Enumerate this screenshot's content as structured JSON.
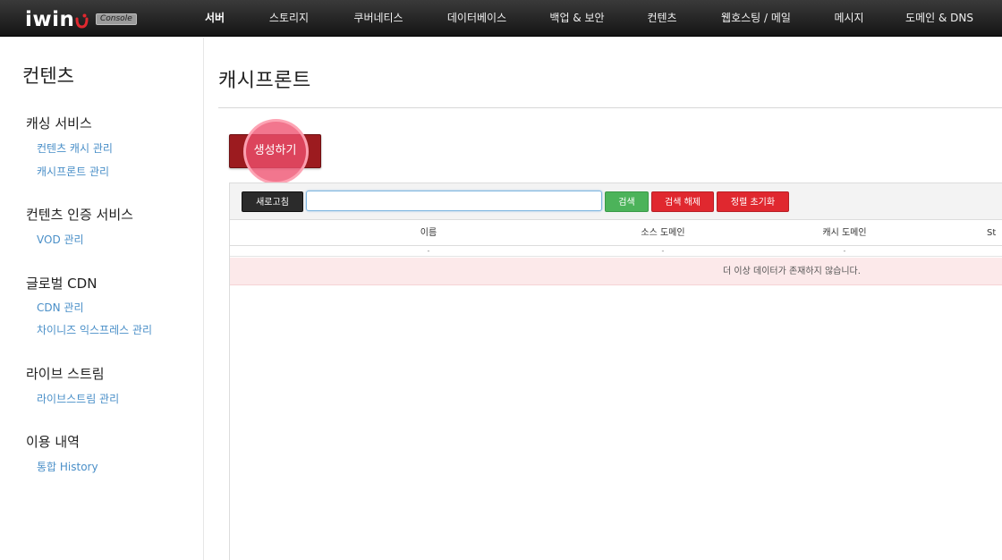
{
  "brand": {
    "logo": "iwin",
    "badge": "Console"
  },
  "topnav": {
    "items": [
      {
        "label": "서버"
      },
      {
        "label": "스토리지"
      },
      {
        "label": "쿠버네티스"
      },
      {
        "label": "데이터베이스"
      },
      {
        "label": "백업 & 보안"
      },
      {
        "label": "컨텐츠"
      },
      {
        "label": "웹호스팅 / 메일"
      },
      {
        "label": "메시지"
      },
      {
        "label": "도메인 & DNS"
      }
    ]
  },
  "sidebar": {
    "title": "컨텐츠",
    "groups": [
      {
        "title": "캐싱 서비스",
        "items": [
          "컨텐츠 캐시 관리",
          "캐시프론트 관리"
        ]
      },
      {
        "title": "컨텐츠 인증 서비스",
        "items": [
          "VOD 관리"
        ]
      },
      {
        "title": "글로벌 CDN",
        "items": [
          "CDN 관리",
          "차이니즈 익스프레스 관리"
        ]
      },
      {
        "title": "라이브 스트림",
        "items": [
          "라이브스트림 관리"
        ]
      },
      {
        "title": "이용 내역",
        "items": [
          "통합 History"
        ]
      }
    ]
  },
  "main": {
    "title": "캐시프론트",
    "create_button": "생성하기",
    "toolbar": {
      "refresh": "새로고침",
      "search_value": "",
      "search": "검색",
      "clear_search": "검색 해제",
      "reset_sort": "정렬 초기화"
    },
    "table": {
      "columns": [
        "이름",
        "소스 도메인",
        "캐시 도메인",
        "St"
      ],
      "filter_placeholders": [
        "-",
        "-",
        "-"
      ],
      "empty_message": "더 이상 데이터가 존재하지 않습니다."
    }
  },
  "colors": {
    "topbar": "#1e1e1e",
    "create_button": "#9c1b1f",
    "highlight": "#ee506e",
    "search_button": "#4cb35a",
    "danger_button": "#e0282f",
    "link": "#4a8fc8",
    "empty_row": "#fce9ea"
  }
}
